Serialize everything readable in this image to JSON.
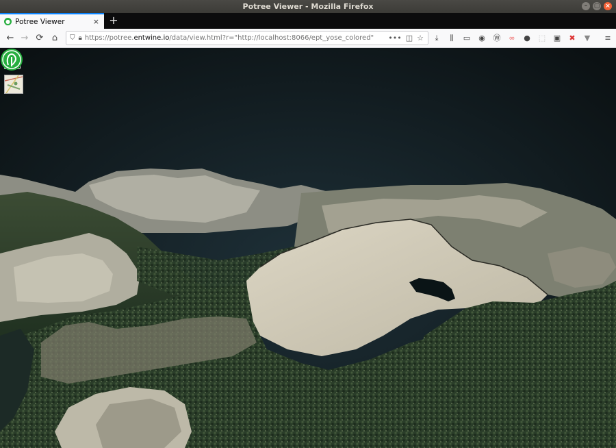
{
  "window": {
    "title": "Potree Viewer - Mozilla Firefox",
    "controls": [
      "–",
      "▢",
      "×"
    ]
  },
  "tabs": [
    {
      "label": "Potree Viewer",
      "close": "×",
      "favicon": "potree-favicon"
    }
  ],
  "new_tab_label": "+",
  "nav": {
    "back": "←",
    "forward": "→",
    "reload": "⟳",
    "home": "⌂",
    "url_prefix": "https://potree.",
    "url_domain": "entwine.io",
    "url_suffix": "/data/view.html?r=\"http://localhost:8066/ept_yose_colored\"",
    "page_actions": "•••"
  },
  "toolbar_icons": [
    "download-icon",
    "library-icon",
    "reader-icon",
    "extension-icon",
    "wordpress-icon",
    "glasses-icon",
    "account-icon",
    "screenshot-icon",
    "image-icon",
    "close-x-icon",
    "chevron-icon",
    "hamburger-menu-icon"
  ],
  "viewer": {
    "menu_icon": "hamburger-icon",
    "map_icon": "minimap-icon",
    "share_icon": "share-icon",
    "logo_icon": "potree-logo-icon",
    "accent": "#27ae3f",
    "sky_color": "#17252b"
  }
}
